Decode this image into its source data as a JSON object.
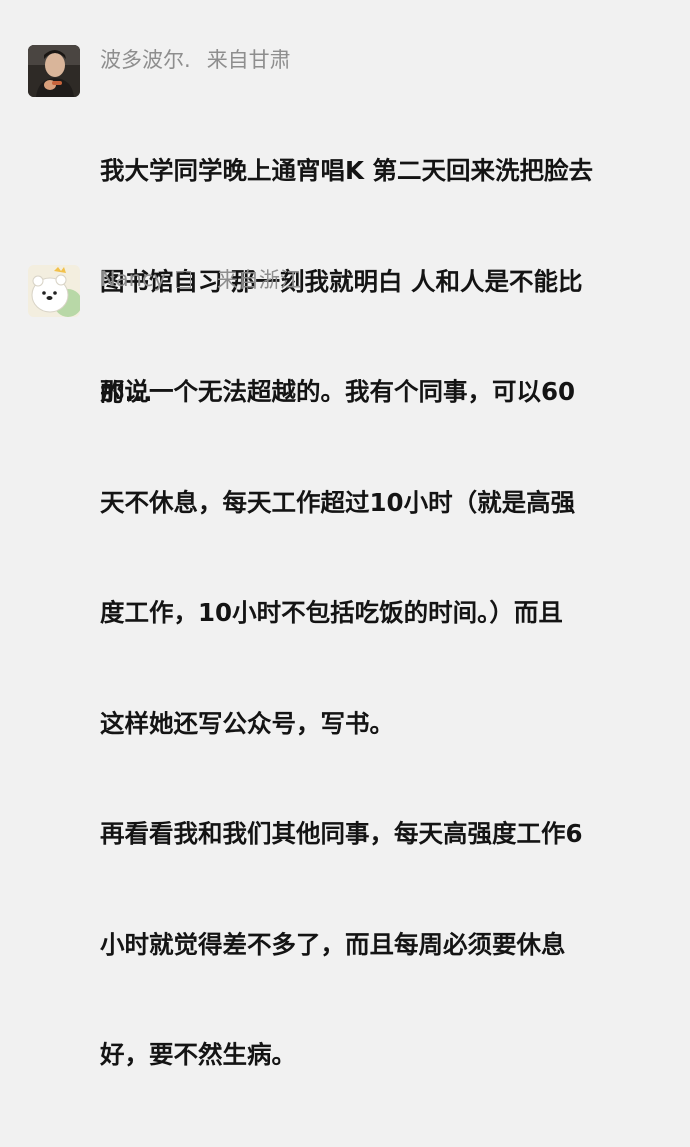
{
  "comments": [
    {
      "username": "波多波尔.",
      "location": "来自甘肃",
      "avatar_icon": "user-avatar-photo-icon",
      "lines": [
        "我大学同学晚上通宵唱K 第二天回来洗把脸去",
        "图书馆自习 那一刻我就明白 人和人是不能比",
        "的..."
      ]
    },
    {
      "username": "Nancy",
      "name_glyph": "□",
      "location": "来自浙江",
      "avatar_icon": "polar-bear-avatar-icon",
      "lines": [
        "那说一个无法超越的。我有个同事，可以60",
        "天不休息，每天工作超过10小时（就是高强",
        "度工作，10小时不包括吃饭的时间。）而且",
        "这样她还写公众号，写书。",
        "再看看我和我们其他同事，每天高强度工作6",
        "小时就觉得差不多了，而且每周必须要休息",
        "好，要不然生病。"
      ]
    }
  ]
}
